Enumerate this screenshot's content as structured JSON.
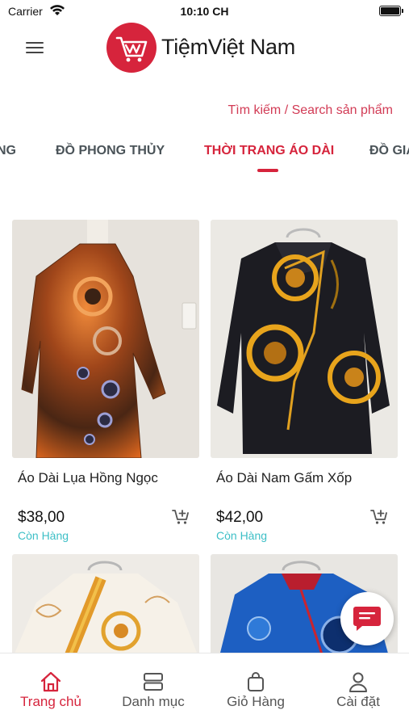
{
  "status_bar": {
    "carrier": "Carrier",
    "time": "10:10 CH"
  },
  "header": {
    "menu_icon": "hamburger-menu-icon",
    "logo_icon": "shopping-cart-logo-icon",
    "brand_name": "TiệmViệt Nam"
  },
  "search": {
    "label": "Tìm kiếm / Search sản phẩm"
  },
  "category_tabs": [
    {
      "label": "NG"
    },
    {
      "label": "ĐỒ PHONG THỦY"
    },
    {
      "label": "THỜI TRANG ÁO DÀI",
      "active": true
    },
    {
      "label": "ĐỒ GIA"
    }
  ],
  "products": [
    {
      "name": "Áo Dài Lụa Hồng Ngọc",
      "price": "$38,00",
      "stock": "Còn Hàng",
      "image": "orange silk ao dai on mannequin"
    },
    {
      "name": "Áo Dài Nam Gấm Xốp",
      "price": "$42,00",
      "stock": "Còn Hàng",
      "image": "black brocade men's ao dai with gold dragon"
    },
    {
      "image": "white ao dai with golden dragon embroidery"
    },
    {
      "image": "blue ao dai with dragon print"
    }
  ],
  "chat_button": {
    "icon": "chat-bubble-icon"
  },
  "bottom_nav": [
    {
      "label": "Trang chủ",
      "icon": "home-icon",
      "active": true
    },
    {
      "label": "Danh mục",
      "icon": "category-icon"
    },
    {
      "label": "Giỏ Hàng",
      "icon": "shopping-bag-icon"
    },
    {
      "label": "Cài đặt",
      "icon": "user-icon"
    }
  ],
  "colors": {
    "accent": "#d6243c",
    "search_text": "#d23b55",
    "in_stock": "#3dbfc6"
  }
}
